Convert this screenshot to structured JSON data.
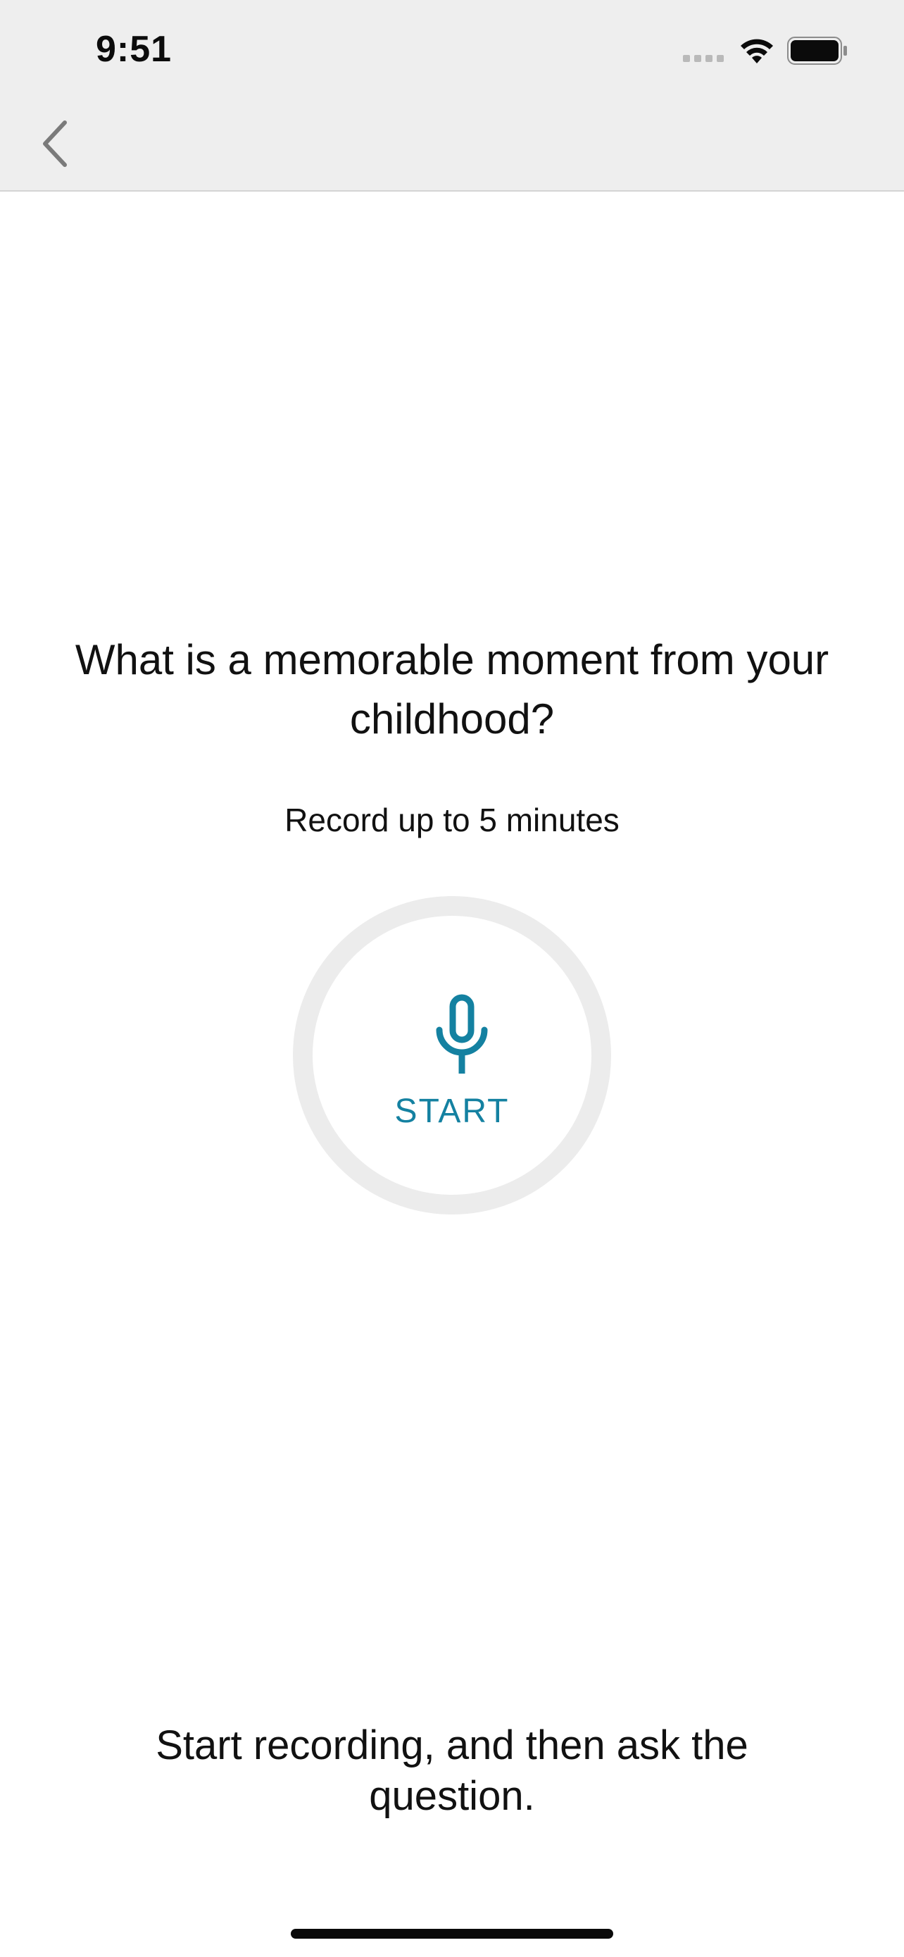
{
  "status_bar": {
    "time": "9:51",
    "icons": [
      "cellular-signal-icon",
      "wifi-icon",
      "battery-icon"
    ]
  },
  "nav": {
    "back_icon": "chevron-left-icon"
  },
  "main": {
    "question": "What is a memorable moment from your childhood?",
    "limit_text": "Record up to 5 minutes",
    "record_button": {
      "icon": "microphone-icon",
      "label": "START"
    },
    "instruction": "Start recording, and then ask the question."
  },
  "colors": {
    "accent": "#1481a1",
    "header_bg": "#eeeeee",
    "ring": "#ececec"
  }
}
